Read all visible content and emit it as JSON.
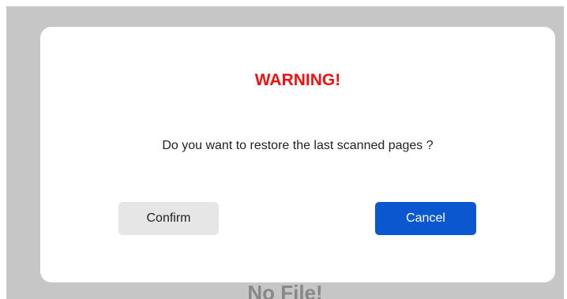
{
  "background": {
    "message": "No File!"
  },
  "dialog": {
    "title": "WARNING!",
    "message": "Do you want to restore the last scanned pages ?",
    "confirm_label": "Confirm",
    "cancel_label": "Cancel"
  },
  "colors": {
    "overlay": "#c6c6c6",
    "title": "#ee1111",
    "confirm_bg": "#e6e6e6",
    "cancel_bg": "#0b57d0"
  }
}
